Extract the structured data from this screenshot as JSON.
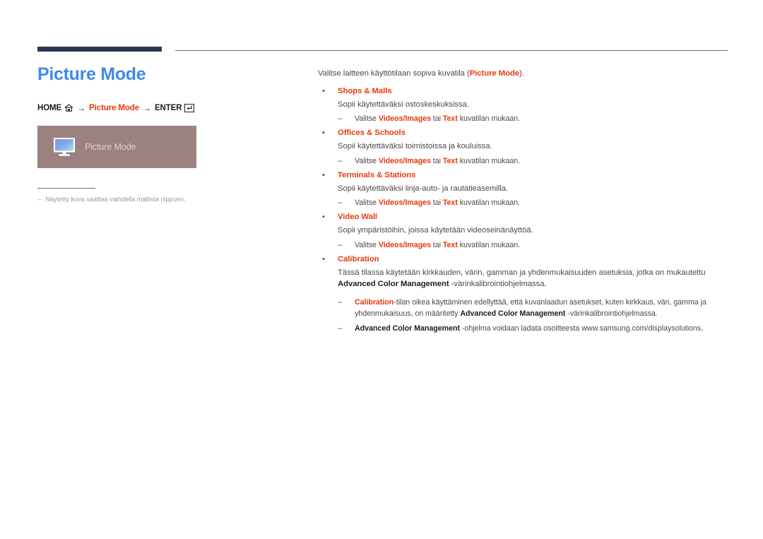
{
  "header": {
    "accent_bar_color": "#2c3751",
    "rule_color": "#6d6a7c"
  },
  "left": {
    "title": "Picture Mode",
    "title_color": "#3d8ae8",
    "breadcrumb": {
      "home_label": "HOME",
      "home_icon": "house-icon",
      "arrow1": "→",
      "menu_label": "Picture Mode",
      "arrow2": "→",
      "enter_label": "ENTER",
      "enter_icon": "enter-key-icon",
      "accent_color": "#e8380d"
    },
    "thumbnail": {
      "background_color": "#9b8180",
      "icon": "monitor-icon",
      "label": "Picture Mode"
    },
    "caption": {
      "dash": "–",
      "text": "Näytetty kuva saattaa vaihdella mallista riippuen."
    }
  },
  "right": {
    "intro_prefix": "Valitse laitteen käyttötilaan sopiva kuvatila (",
    "intro_bold": "Picture Mode",
    "intro_suffix": ").",
    "bullet_marker": "•",
    "sub_marker": "–",
    "modes": [
      {
        "title": "Shops & Malls",
        "description": "Sopii käytettäväksi ostoskeskuksissa.",
        "sub": {
          "prefix": "Valitse ",
          "bold1": "Videos/Images",
          "middle": " tai ",
          "bold2": "Text",
          "suffix": " kuvatilan mukaan."
        }
      },
      {
        "title": "Offices & Schools",
        "description": "Sopii käytettäväksi toimistoissa ja kouluissa.",
        "sub": {
          "prefix": "Valitse ",
          "bold1": "Videos/Images",
          "middle": " tai ",
          "bold2": "Text",
          "suffix": " kuvatilan mukaan."
        }
      },
      {
        "title": "Terminals & Stations",
        "description": "Sopii käytettäväksi linja-auto- ja rautatieasemilla.",
        "sub": {
          "prefix": "Valitse ",
          "bold1": "Videos/Images",
          "middle": " tai ",
          "bold2": "Text",
          "suffix": " kuvatilan mukaan."
        }
      },
      {
        "title": "Video Wall",
        "description": "Sopii ympäristöihin, joissa käytetään videoseinänäyttöä.",
        "sub": {
          "prefix": "Valitse ",
          "bold1": "Videos/Images",
          "middle": " tai ",
          "bold2": "Text",
          "suffix": " kuvatilan mukaan."
        }
      }
    ],
    "calibration": {
      "title": "Calibration",
      "desc_prefix": "Tässä tilassa käytetään kirkkauden, värin, gamman ja yhdenmukaisuuden asetuksia, jotka on mukautettu ",
      "desc_bold": "Advanced Color Management",
      "desc_suffix": " -värinkalibrointiohjelmassa.",
      "notes": [
        {
          "red_lead": "Calibration",
          "text_after_red": "-tilan oikea käyttäminen edellyttää, että kuvanlaadun asetukset, kuten kirkkaus, väri, gamma ja yhdenmukaisuus, on määritetty ",
          "bold_mid": "Advanced Color Management",
          "text_end": " -värinkalibrointiohjelmassa."
        },
        {
          "bold_lead": "Advanced Color Management",
          "text_end": " -ohjelma voidaan ladata osoitteesta www.samsung.com/displaysolutions."
        }
      ]
    }
  }
}
